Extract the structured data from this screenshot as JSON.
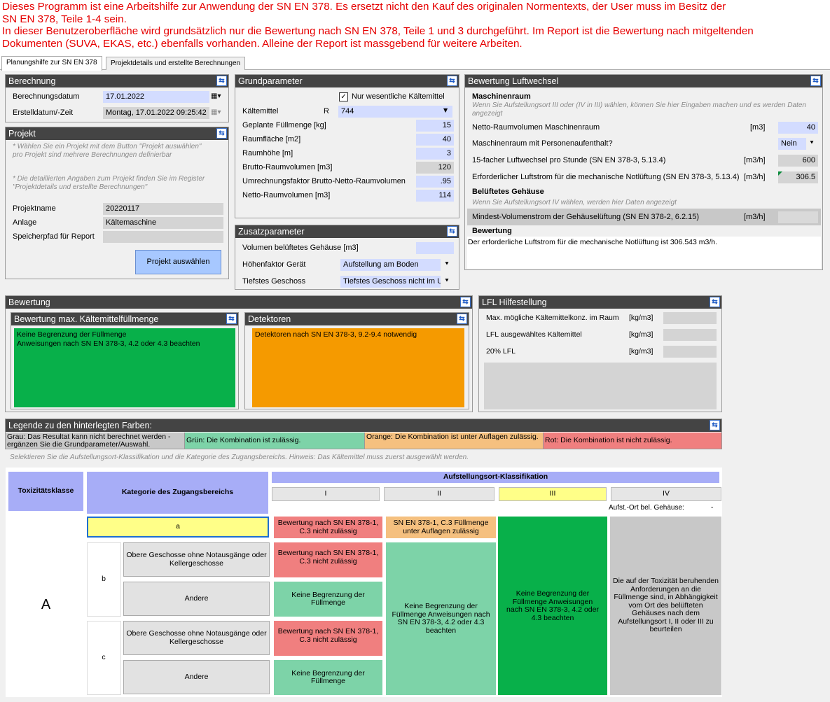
{
  "warning": {
    "line1": "Dieses Programm ist eine Arbeitshilfe zur Anwendung der SN EN 378. Es ersetzt nicht den Kauf des originalen Normentexts, der User muss im Besitz der",
    "line2": "SN EN 378, Teile 1-4 sein.",
    "line3": "In dieser Benutzeroberfläche wird grundsätzlich nur die Bewertung nach SN EN 378, Teile 1 und 3 durchgeführt. Im Report ist die Bewertung nach mitgeltenden",
    "line4": "Dokumenten (SUVA, EKAS, etc.) ebenfalls vorhanden. Alleine der Report ist massgebend für weitere Arbeiten."
  },
  "tabs": [
    "Planungshilfe zur SN EN 378",
    "Projektdetails und erstellte Berechnungen"
  ],
  "berechnung": {
    "title": "Berechnung",
    "date_label": "Berechnungsdatum",
    "date_value": "17.01.2022",
    "created_label": "Erstelldatum/-Zeit",
    "created_value": "Montag, 17.01.2022 09:25:42"
  },
  "projekt": {
    "title": "Projekt",
    "note1": "* Wählen Sie ein Projekt mit dem Button \"Projekt auswählen\" pro Projekt sind mehrere Berechnungen definierbar",
    "note2": "* Die detaillierten Angaben zum Projekt finden Sie im Register \"Projektdetails und erstellte Berechnungen\"",
    "name_label": "Projektname",
    "name_value": "20220117",
    "anlage_label": "Anlage",
    "anlage_value": "Kältemaschine",
    "pfad_label": "Speicherpfad für Report",
    "pfad_value": "",
    "button": "Projekt auswählen"
  },
  "grund": {
    "title": "Grundparameter",
    "checkbox_label": "Nur wesentliche Kältemittel",
    "kaeltemittel_label": "Kältemittel",
    "kaeltemittel_prefix": "R",
    "kaeltemittel_value": "744",
    "rows": [
      {
        "label": "Geplante Füllmenge [kg]",
        "value": "15",
        "style": "blue"
      },
      {
        "label": "Raumfläche [m2]",
        "value": "40",
        "style": "blue"
      },
      {
        "label": "Raumhöhe [m]",
        "value": "3",
        "style": "blue"
      },
      {
        "label": "Brutto-Raumvolumen [m3]",
        "value": "120",
        "style": "grey"
      },
      {
        "label": "Umrechnungsfaktor Brutto-Netto-Raumvolumen",
        "value": ".95",
        "style": "blue"
      },
      {
        "label": "Netto-Raumvolumen [m3]",
        "value": "114",
        "style": "blue"
      }
    ]
  },
  "zusatz": {
    "title": "Zusatzparameter",
    "vol_label": "Volumen belüftetes Gehäuse [m3]",
    "vol_value": "",
    "hoehe_label": "Höhenfaktor Gerät",
    "hoehe_value": "Aufstellung am Boden",
    "geschoss_label": "Tiefstes Geschoss",
    "geschoss_value": "Tiefstes Geschoss nicht im U"
  },
  "luft": {
    "title": "Bewertung Luftwechsel",
    "masch_title": "Maschinenraum",
    "masch_note": "Wenn Sie Aufstellungsort III oder (IV in III) wählen, können Sie hier Eingaben machen und es werden Daten angezeigt",
    "netto_label": "Netto-Raumvolumen Maschinenraum",
    "netto_unit": "[m3]",
    "netto_value": "40",
    "person_label": "Maschinenraum mit Personenaufenthalt?",
    "person_value": "Nein",
    "fach_label": "15-facher Luftwechsel pro Stunde (SN EN 378-3, 5.13.4)",
    "fach_unit": "[m3/h]",
    "fach_value": "600",
    "erf_label": "Erforderlicher Luftstrom für die mechanische Notlüftung (SN EN 378-3, 5.13.4)",
    "erf_unit": "[m3/h]",
    "erf_value": "306.5",
    "gehaeuse_title": "Belüftetes Gehäuse",
    "gehaeuse_note": "Wenn Sie Aufstellungsort IV wählen, werden hier Daten angezeigt",
    "mindest_label": "Mindest-Volumenstrom der Gehäuselüftung (SN EN 378-2, 6.2.15)",
    "mindest_unit": "[m3/h]",
    "mindest_value": "",
    "bew_title": "Bewertung",
    "bew_text": "Der erforderliche Luftstrom für die mechanische Notlüftung ist 306.543 m3/h."
  },
  "bewertung": {
    "title": "Bewertung",
    "fuell_title": "Bewertung max. Kältemittelfüllmenge",
    "fuell_line1": "Keine Begrenzung der Füllmenge",
    "fuell_line2": "Anweisungen nach SN EN 378-3, 4.2 oder 4.3 beachten",
    "det_title": "Detektoren",
    "det_text": "Detektoren nach SN EN 378-3, 9.2-9.4 notwendig"
  },
  "lfl": {
    "title": "LFL Hilfestellung",
    "rows": [
      {
        "label": "Max. mögliche Kältemittelkonz. im Raum",
        "unit": "[kg/m3]",
        "value": ""
      },
      {
        "label": "LFL ausgewähltes Kältemittel",
        "unit": "[kg/m3]",
        "value": ""
      },
      {
        "label": "20% LFL",
        "unit": "[kg/m3]",
        "value": ""
      }
    ]
  },
  "legende": {
    "title": "Legende zu den hinterlegten Farben:",
    "grey": "Grau: Das Resultat kann nicht berechnet werden - ergänzen Sie die Grundparameter/Auswahl.",
    "green": "Grün: Die Kombination ist zulässig.",
    "orange": "Orange: Die Kombination ist unter Auflagen zulässig.",
    "red": "Rot: Die Kombination ist nicht zulässig."
  },
  "hint": "Selektieren Sie die Aufstellungsort-Klassifikation und die Kategorie des Zugangsbereichs. Hinweis: Das Kältemittel muss zuerst ausgewählt werden.",
  "matrix": {
    "tox_header": "Toxizitätsklasse",
    "kat_header": "Kategorie des Zugangsbereichs",
    "aufst_header": "Aufstellungsort-Klassifikation",
    "cols": [
      "I",
      "II",
      "III",
      "IV"
    ],
    "gehaeuse_label": "Aufst.-Ort bel. Gehäuse:",
    "gehaeuse_value": "-",
    "tox_value": "A",
    "cat_a": "a",
    "cat_b": "b",
    "cat_c": "c",
    "sub_obere": "Obere Geschosse ohne Notausgänge oder Kellergeschosse",
    "sub_andere": "Andere",
    "r_a_I": "Bewertung nach SN EN 378-1, C.3 nicht zulässig",
    "r_a_II": "SN EN 378-1, C.3 Füllmenge unter Auflagen zulässig",
    "r_b1_I": "Bewertung nach SN EN 378-1, C.3 nicht zulässig",
    "r_b2_I": "Keine Begrenzung der Füllmenge",
    "r_c1_I": "Bewertung nach SN EN 378-1, C.3 nicht zulässig",
    "r_c2_I": "Keine Begrenzung der Füllmenge",
    "r_II_main": "Keine Begrenzung der Füllmenge Anweisungen nach SN EN 378-3, 4.2 oder 4.3 beachten",
    "r_III_main": "Keine Begrenzung der Füllmenge Anweisungen nach SN EN 378-3, 4.2 oder 4.3 beachten",
    "r_IV_main": "Die auf der Toxizität beruhenden Anforderungen an die Füllmenge sind, in Abhängigkeit vom Ort des belüfteten Gehäuses nach dem Aufstellungsort I, II oder III zu beurteilen"
  },
  "colors": {
    "red": "#f07f7f",
    "green": "#7dd3a8",
    "dark_green": "#08b04a",
    "orange": "#f5c07f",
    "grey": "#c8c8c8",
    "header": "#a7adf7",
    "warning": "#e60000"
  }
}
